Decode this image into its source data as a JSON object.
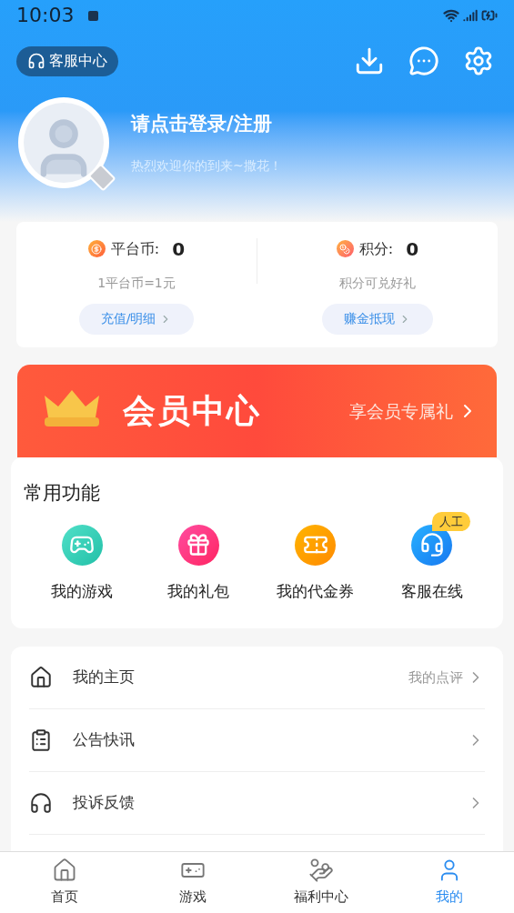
{
  "status_bar": {
    "time": "10:03"
  },
  "header": {
    "support_button": "客服中心"
  },
  "profile": {
    "title": "请点击登录/注册",
    "subtitle": "热烈欢迎你的到来~撒花！"
  },
  "wallet": [
    {
      "kind": "coin",
      "label": "平台币:",
      "value": "0",
      "note": "1平台币=1元",
      "action": "充值/明细"
    },
    {
      "kind": "points",
      "label": "积分:",
      "value": "0",
      "note": "积分可兑好礼",
      "action": "赚金抵现"
    }
  ],
  "vip_banner": {
    "title": "会员中心",
    "link": "享会员专属礼"
  },
  "common_functions": {
    "title": "常用功能",
    "items": [
      {
        "kind": "game",
        "label": "我的游戏"
      },
      {
        "kind": "gift",
        "label": "我的礼包"
      },
      {
        "kind": "voucher",
        "label": "我的代金券"
      },
      {
        "kind": "support",
        "label": "客服在线",
        "badge": "人工"
      }
    ]
  },
  "menu": [
    {
      "kind": "home",
      "label": "我的主页",
      "extra": "我的点评"
    },
    {
      "kind": "notice",
      "label": "公告快讯"
    },
    {
      "kind": "feedback",
      "label": "投诉反馈"
    }
  ],
  "tab_bar": [
    {
      "kind": "home",
      "label": "首页",
      "selected": false
    },
    {
      "kind": "games",
      "label": "游戏",
      "selected": false
    },
    {
      "kind": "welfare",
      "label": "福利中心",
      "selected": false
    },
    {
      "kind": "me",
      "label": "我的",
      "selected": true
    }
  ]
}
